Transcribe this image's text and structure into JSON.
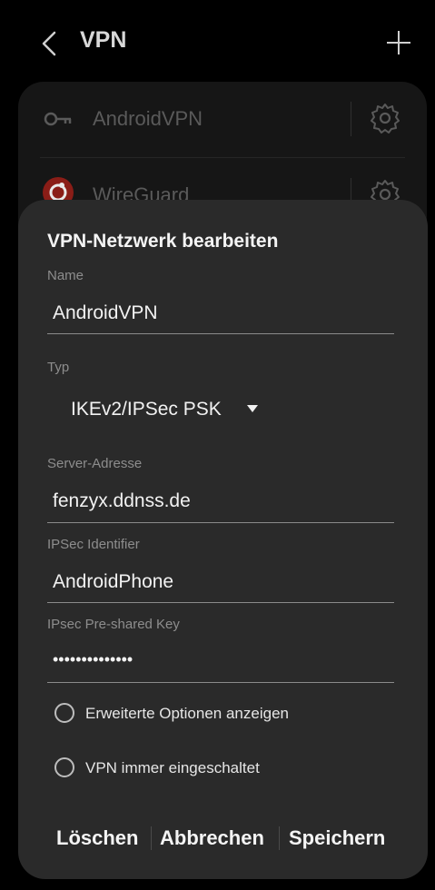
{
  "header": {
    "title": "VPN"
  },
  "vpn_list": [
    {
      "name": "AndroidVPN",
      "icon": "key-icon"
    },
    {
      "name": "WireGuard",
      "icon": "wireguard-logo-icon"
    }
  ],
  "dialog": {
    "title": "VPN-Netzwerk bearbeiten",
    "name_label": "Name",
    "name_value": "AndroidVPN",
    "type_label": "Typ",
    "type_value": "IKEv2/IPSec PSK",
    "server_label": "Server-Adresse",
    "server_value": "fenzyx.ddnss.de",
    "ipsec_id_label": "IPSec Identifier",
    "ipsec_id_value": "AndroidPhone",
    "psk_label": "IPsec Pre-shared Key",
    "psk_value": "••••••••••••••",
    "advanced_label": "Erweiterte Optionen anzeigen",
    "always_on_label": "VPN immer eingeschaltet",
    "delete_label": "Löschen",
    "cancel_label": "Abbrechen",
    "save_label": "Speichern"
  },
  "colors": {
    "dialog_bg": "#2a2a2a",
    "accent_wireguard": "#c0261d"
  }
}
